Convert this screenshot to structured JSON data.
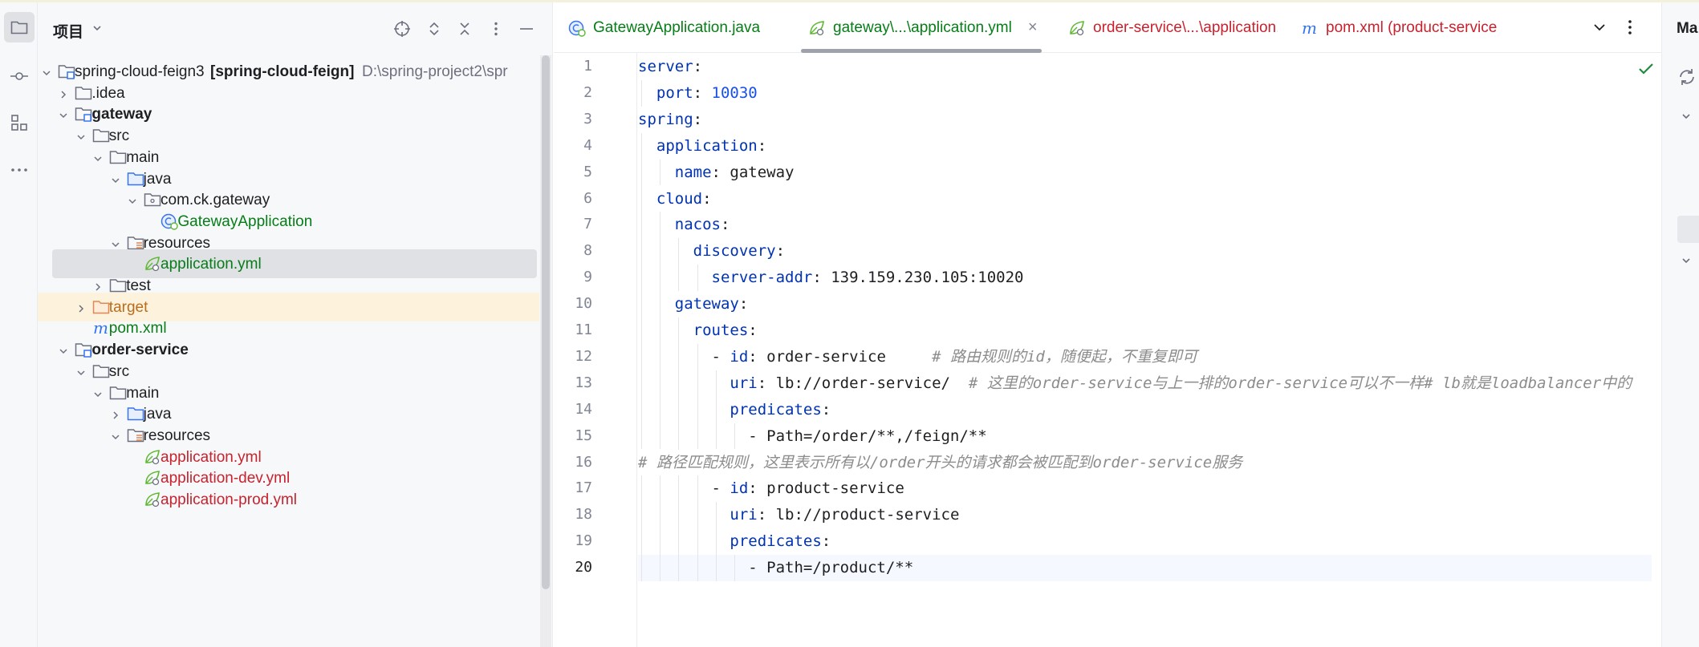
{
  "project_panel": {
    "title": "项目",
    "tree": [
      {
        "label": "spring-cloud-feign3",
        "suffix": "[spring-cloud-feign]",
        "path": "D:\\spring-project2\\spr",
        "icon": "module-folder-icon",
        "chev": "down",
        "style": "normal",
        "depth": 0
      },
      {
        "label": ".idea",
        "icon": "folder-icon",
        "chev": "right",
        "style": "normal",
        "depth": 1
      },
      {
        "label": "gateway",
        "icon": "module-folder-icon",
        "chev": "down",
        "style": "bold",
        "depth": 1
      },
      {
        "label": "src",
        "icon": "folder-icon",
        "chev": "down",
        "style": "normal",
        "depth": 2
      },
      {
        "label": "main",
        "icon": "folder-icon",
        "chev": "down",
        "style": "normal",
        "depth": 3
      },
      {
        "label": "java",
        "icon": "source-folder-icon",
        "chev": "down",
        "style": "normal",
        "depth": 4
      },
      {
        "label": "com.ck.gateway",
        "icon": "package-icon",
        "chev": "down",
        "style": "normal",
        "depth": 5
      },
      {
        "label": "GatewayApplication",
        "icon": "spring-boot-class-icon",
        "chev": "",
        "style": "green",
        "depth": 6
      },
      {
        "label": "resources",
        "icon": "resources-folder-icon",
        "chev": "down",
        "style": "normal",
        "depth": 4
      },
      {
        "label": "application.yml",
        "icon": "yaml-spring-icon",
        "chev": "",
        "style": "green",
        "depth": 5,
        "selected": true
      },
      {
        "label": "test",
        "icon": "folder-icon",
        "chev": "right",
        "style": "normal",
        "depth": 3
      },
      {
        "label": "target",
        "icon": "excluded-folder-icon",
        "chev": "right",
        "style": "orange",
        "depth": 2,
        "excluded": true
      },
      {
        "label": "pom.xml",
        "icon": "maven-icon",
        "chev": "",
        "style": "green",
        "depth": 2
      },
      {
        "label": "order-service",
        "icon": "module-folder-icon",
        "chev": "down",
        "style": "bold",
        "depth": 1
      },
      {
        "label": "src",
        "icon": "folder-icon",
        "chev": "down",
        "style": "normal",
        "depth": 2
      },
      {
        "label": "main",
        "icon": "folder-icon",
        "chev": "down",
        "style": "normal",
        "depth": 3
      },
      {
        "label": "java",
        "icon": "source-folder-icon",
        "chev": "right",
        "style": "normal",
        "depth": 4
      },
      {
        "label": "resources",
        "icon": "resources-folder-icon",
        "chev": "down",
        "style": "normal",
        "depth": 4
      },
      {
        "label": "application.yml",
        "icon": "yaml-spring-icon",
        "chev": "",
        "style": "red",
        "depth": 5
      },
      {
        "label": "application-dev.yml",
        "icon": "yaml-spring-icon",
        "chev": "",
        "style": "red",
        "depth": 5
      },
      {
        "label": "application-prod.yml",
        "icon": "yaml-spring-icon",
        "chev": "",
        "style": "red",
        "depth": 5
      }
    ]
  },
  "editor": {
    "tabs": [
      {
        "label": "GatewayApplication.java",
        "icon": "spring-boot-class-icon",
        "color": "#067d17",
        "active": false
      },
      {
        "label": "gateway\\...\\application.yml",
        "icon": "yaml-spring-icon",
        "color": "#067d17",
        "active": true,
        "closable": "×"
      },
      {
        "label": "order-service\\...\\application.yml",
        "icon": "yaml-spring-icon",
        "color": "#c7222d",
        "active": false
      },
      {
        "label": "pom.xml (product-service",
        "icon": "maven-icon",
        "color": "#c7222d",
        "active": false
      }
    ],
    "current_line": 20,
    "lines": [
      [
        {
          "t": "server",
          "c": "k"
        },
        {
          "t": ":",
          "c": "p"
        }
      ],
      [
        {
          "t": "  port",
          "c": "k"
        },
        {
          "t": ": ",
          "c": "p"
        },
        {
          "t": "10030",
          "c": "n"
        }
      ],
      [
        {
          "t": "spring",
          "c": "k"
        },
        {
          "t": ":",
          "c": "p"
        }
      ],
      [
        {
          "t": "  application",
          "c": "k"
        },
        {
          "t": ":",
          "c": "p"
        }
      ],
      [
        {
          "t": "    name",
          "c": "k"
        },
        {
          "t": ": ",
          "c": "p"
        },
        {
          "t": "gateway",
          "c": "s"
        }
      ],
      [
        {
          "t": "  cloud",
          "c": "k"
        },
        {
          "t": ":",
          "c": "p"
        }
      ],
      [
        {
          "t": "    nacos",
          "c": "k"
        },
        {
          "t": ":",
          "c": "p"
        }
      ],
      [
        {
          "t": "      discovery",
          "c": "k"
        },
        {
          "t": ":",
          "c": "p"
        }
      ],
      [
        {
          "t": "        server-addr",
          "c": "k"
        },
        {
          "t": ": ",
          "c": "p"
        },
        {
          "t": "139.159.230.105:10020",
          "c": "s"
        }
      ],
      [
        {
          "t": "    gateway",
          "c": "k"
        },
        {
          "t": ":",
          "c": "p"
        }
      ],
      [
        {
          "t": "      routes",
          "c": "k"
        },
        {
          "t": ":",
          "c": "p"
        }
      ],
      [
        {
          "t": "        - ",
          "c": "p"
        },
        {
          "t": "id",
          "c": "k"
        },
        {
          "t": ": ",
          "c": "p"
        },
        {
          "t": "order-service",
          "c": "s"
        },
        {
          "t": "     # 路由规则的id，随便起，不重复即可",
          "c": "cm"
        }
      ],
      [
        {
          "t": "          uri",
          "c": "k"
        },
        {
          "t": ": ",
          "c": "p"
        },
        {
          "t": "lb://order-service/",
          "c": "s"
        },
        {
          "t": "  # 这里的order-service与上一排的order-service可以不一样# lb就是loadbalancer中的",
          "c": "cm"
        }
      ],
      [
        {
          "t": "          predicates",
          "c": "k"
        },
        {
          "t": ":",
          "c": "p"
        }
      ],
      [
        {
          "t": "            - Path=/order/**,/feign/**",
          "c": "s"
        }
      ],
      [
        {
          "t": "# 路径匹配规则，这里表示所有以/order开头的请求都会被匹配到order-service服务",
          "c": "cm"
        }
      ],
      [
        {
          "t": "        - ",
          "c": "p"
        },
        {
          "t": "id",
          "c": "k"
        },
        {
          "t": ": ",
          "c": "p"
        },
        {
          "t": "product-service",
          "c": "s"
        }
      ],
      [
        {
          "t": "          uri",
          "c": "k"
        },
        {
          "t": ": ",
          "c": "p"
        },
        {
          "t": "lb://product-service",
          "c": "s"
        }
      ],
      [
        {
          "t": "          predicates",
          "c": "k"
        },
        {
          "t": ":",
          "c": "p"
        }
      ],
      [
        {
          "t": "            - Path=/product/**",
          "c": "s"
        }
      ]
    ]
  },
  "right_panel": {
    "title": "Ma"
  },
  "colors": {
    "keyword": "#0033b3",
    "number": "#1750eb",
    "comment": "#8c8c8c",
    "green_file": "#067d17",
    "red_file": "#c7222d"
  }
}
